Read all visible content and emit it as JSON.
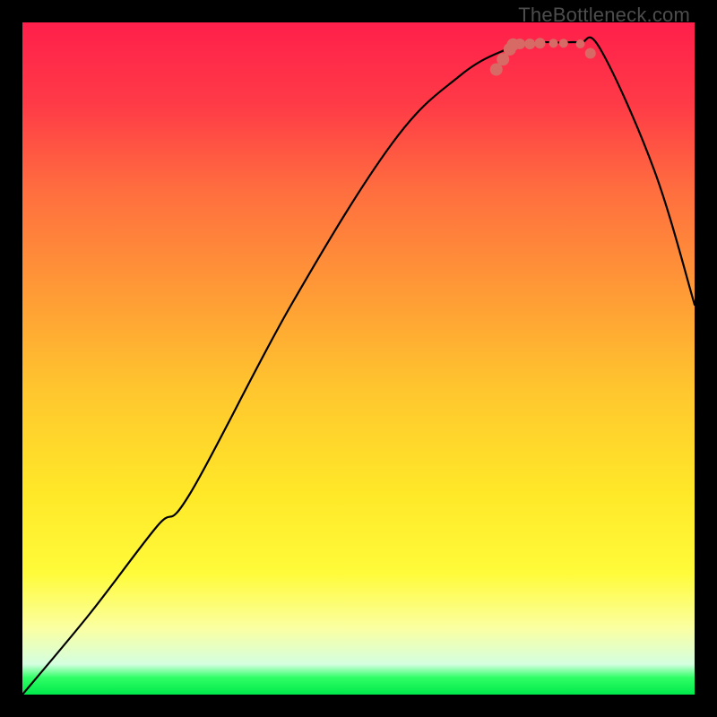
{
  "watermark": "TheBottleneck.com",
  "gradient_stops": [
    {
      "offset": 0.0,
      "color": "#ff1f4b"
    },
    {
      "offset": 0.12,
      "color": "#ff3a47"
    },
    {
      "offset": 0.25,
      "color": "#ff6e3f"
    },
    {
      "offset": 0.4,
      "color": "#ff9a36"
    },
    {
      "offset": 0.55,
      "color": "#ffc72e"
    },
    {
      "offset": 0.7,
      "color": "#ffe828"
    },
    {
      "offset": 0.82,
      "color": "#fffb3a"
    },
    {
      "offset": 0.9,
      "color": "#fbffa0"
    },
    {
      "offset": 0.955,
      "color": "#d4ffe0"
    },
    {
      "offset": 0.975,
      "color": "#2fff66"
    },
    {
      "offset": 1.0,
      "color": "#00e84a"
    }
  ],
  "chart_data": {
    "type": "line",
    "title": "",
    "xlabel": "",
    "ylabel": "",
    "xlim": [
      0,
      100
    ],
    "ylim": [
      0,
      100
    ],
    "series": [
      {
        "name": "bottleneck-curve",
        "x": [
          0,
          10,
          20,
          25,
          40,
          55,
          65,
          72,
          76,
          80,
          83,
          86,
          94,
          100
        ],
        "values": [
          0,
          12,
          25,
          30,
          58,
          82,
          92,
          96,
          97,
          97,
          97,
          96,
          78,
          58
        ]
      }
    ],
    "markers": {
      "name": "highlighted-points",
      "color": "#d76a64",
      "points": [
        {
          "x": 70.5,
          "y": 93.0,
          "r": 7
        },
        {
          "x": 71.5,
          "y": 94.5,
          "r": 7
        },
        {
          "x": 72.5,
          "y": 96.0,
          "r": 7
        },
        {
          "x": 73.0,
          "y": 96.7,
          "r": 7
        },
        {
          "x": 74.0,
          "y": 96.8,
          "r": 6
        },
        {
          "x": 75.5,
          "y": 96.8,
          "r": 6
        },
        {
          "x": 77.0,
          "y": 96.9,
          "r": 6
        },
        {
          "x": 79.0,
          "y": 96.9,
          "r": 5
        },
        {
          "x": 80.5,
          "y": 96.9,
          "r": 5
        },
        {
          "x": 83.0,
          "y": 96.8,
          "r": 5
        },
        {
          "x": 84.5,
          "y": 95.4,
          "r": 6
        }
      ]
    }
  }
}
